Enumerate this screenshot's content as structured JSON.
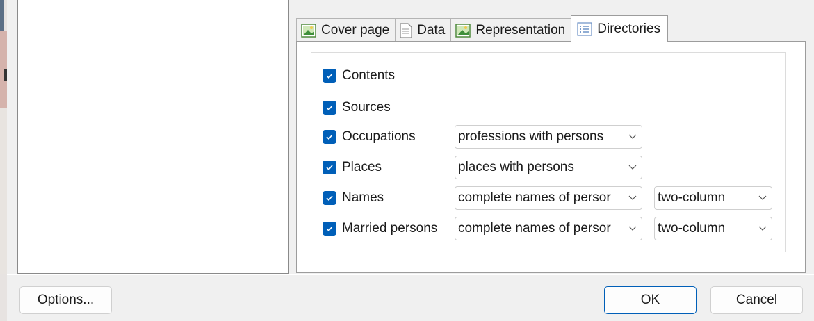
{
  "tabs": [
    {
      "label": "Cover page",
      "icon": "image-icon"
    },
    {
      "label": "Data",
      "icon": "document-icon"
    },
    {
      "label": "Representation",
      "icon": "image-icon"
    },
    {
      "label": "Directories",
      "icon": "list-icon"
    }
  ],
  "active_tab": "Directories",
  "directories": {
    "contents": {
      "label": "Contents",
      "checked": true
    },
    "sources": {
      "label": "Sources",
      "checked": true
    },
    "occupations": {
      "label": "Occupations",
      "checked": true,
      "select": "professions with persons"
    },
    "places": {
      "label": "Places",
      "checked": true,
      "select": "places with persons"
    },
    "names": {
      "label": "Names",
      "checked": true,
      "select": "complete names of persor",
      "layout": "two-column"
    },
    "married": {
      "label": "Married persons",
      "checked": true,
      "select": "complete names of persor",
      "layout": "two-column"
    }
  },
  "buttons": {
    "options": "Options...",
    "ok": "OK",
    "cancel": "Cancel"
  },
  "colors": {
    "accent": "#005fb8",
    "panel_bg": "#ffffff",
    "window_bg": "#f0f0f0"
  }
}
